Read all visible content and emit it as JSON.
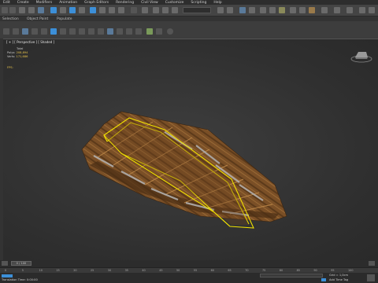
{
  "menu": [
    "Edit",
    "Create",
    "Modifiers",
    "Animation",
    "Graph Editors",
    "Rendering",
    "Civil View",
    "Customize",
    "Scripting",
    "Help"
  ],
  "subtabs": [
    "Selection",
    "Object Paint",
    "Populate"
  ],
  "viewport": {
    "label": "[ + ] [ Perspective ] [ Shaded ]",
    "stats_title": "Total",
    "polys_label": "Polys:",
    "polys_value": "208,894",
    "verts_label": "Verts:",
    "verts_value": "171,686",
    "fps_label": "FPS:"
  },
  "timeline": {
    "frame_label": "0 / 100"
  },
  "ruler_ticks": [
    "0",
    "5",
    "10",
    "15",
    "20",
    "25",
    "30",
    "35",
    "40",
    "45",
    "50",
    "55",
    "60",
    "65",
    "70",
    "75",
    "80",
    "85",
    "90",
    "95",
    "100"
  ],
  "status": {
    "left": "Translation Time: 0:00:00",
    "grid": "Grid = 1,0cm",
    "add_time_tag": "Add Time Tag",
    "selection_set": "Create Selection Se"
  },
  "colors": {
    "selection": "#f0e000",
    "wood": "#8a5a2b",
    "accent_blue": "#3c8fd8"
  }
}
